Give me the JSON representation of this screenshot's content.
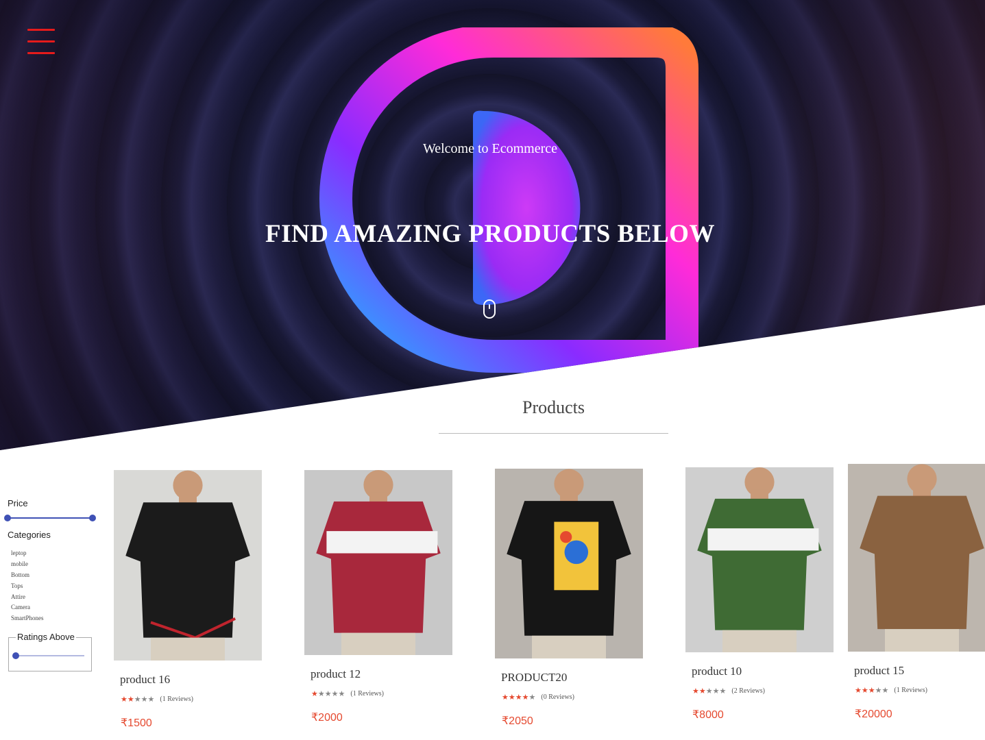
{
  "hero": {
    "welcome": "Welcome to Ecommerce",
    "headline": "FIND AMAZING PRODUCTS BELOW",
    "menu_icon": "hamburger-icon",
    "scroll_icon": "mouse-icon"
  },
  "products_heading": "Products",
  "filters": {
    "price_label": "Price",
    "categories_label": "Categories",
    "categories": [
      "leptop",
      "mobile",
      "Bottom",
      "Tops",
      "Attire",
      "Camera",
      "SmartPhones"
    ],
    "ratings_label": "Ratings Above",
    "ratings_value": 0
  },
  "colors": {
    "accent": "#e5492f",
    "menu": "#e61b1b",
    "slider": "#3f51b5"
  },
  "products": [
    {
      "name": "product 16",
      "rating": 2,
      "reviews": "(1 Reviews)",
      "price": "₹1500",
      "shirt": "#1b1b1b",
      "stripe": "#ffffff",
      "bg": "#d9d9d6"
    },
    {
      "name": "product 12",
      "rating": 1,
      "reviews": "(1 Reviews)",
      "price": "₹2000",
      "shirt": "#a8283c",
      "stripe": "#f3f3f3",
      "bg": "#c8c8c8"
    },
    {
      "name": "PRODUCT20",
      "rating": 4,
      "reviews": "(0 Reviews)",
      "price": "₹2050",
      "shirt": "#161616",
      "stripe": "#2b6fd6",
      "bg": "#b9b4ae"
    },
    {
      "name": "product 10",
      "rating": 2,
      "reviews": "(2 Reviews)",
      "price": "₹8000",
      "shirt": "#3f6b34",
      "stripe": "#f3f3f3",
      "bg": "#cfcfcf"
    },
    {
      "name": "product 15",
      "rating": 3,
      "reviews": "(1 Reviews)",
      "price": "₹20000",
      "shirt": "#8a6240",
      "stripe": "#8a6240",
      "bg": "#bdb6ae"
    }
  ]
}
